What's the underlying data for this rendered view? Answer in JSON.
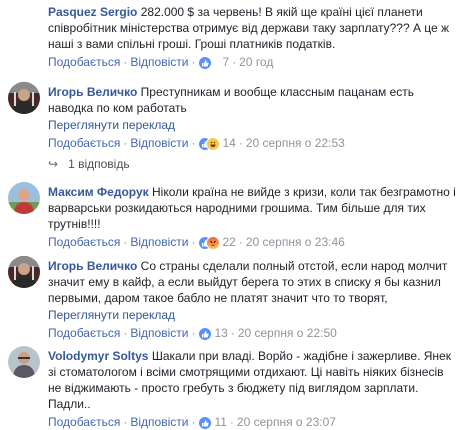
{
  "comments": [
    {
      "author": "Pasquez Sergio",
      "text": "282.000 $ за червень! В якій ще країні цієї планети співробітник міністерства отримує від держави таку зарплату??? А це ж наші з вами спільні гроші. Гроші платників податків.",
      "like_label": "Подобається",
      "reply_label": "Відповісти",
      "reaction_count": "7",
      "time": "20 год"
    },
    {
      "author": "Игорь Величко",
      "text": "Преступникам и вообще классным пацанам есть наводка по ком работать",
      "translate_label": "Переглянути переклад",
      "like_label": "Подобається",
      "reply_label": "Відповісти",
      "reaction_count": "14",
      "time": "20 серпня о 22:53"
    },
    {
      "author": "Максим Федорук",
      "text": "Ніколи країна не вийде з кризи, коли так безграмотно і варварськи розкидаються народними грошима. Тим більше для тих трутнів!!!!",
      "like_label": "Подобається",
      "reply_label": "Відповісти",
      "reaction_count": "22",
      "time": "20 серпня о 23:46"
    },
    {
      "author": "Игорь Величко",
      "text": "Со страны сделали полный отстой, если народ молчит значит ему в кайф, а если выйдут берега то этих в списку я бы казнил первыми, даром такое бабло не платят значит что то творят,",
      "translate_label": "Переглянути переклад",
      "like_label": "Подобається",
      "reply_label": "Відповісти",
      "reaction_count": "13",
      "time": "20 серпня о 22:50"
    },
    {
      "author": "Volodymyr Soltys",
      "text": "Шакали при владі. Ворйо - жадібне і зажерливе. Янек зі стоматологом і всіми смотрящими отдихают. Ці навіть ніяких бізнесів не віджимають - просто гребуть з бюджету під виглядом зарплати. Падли..",
      "like_label": "Подобається",
      "reply_label": "Відповісти",
      "reaction_count": "11",
      "time": "20 серпня о 23:07"
    }
  ],
  "replies_link": "1 відповідь"
}
